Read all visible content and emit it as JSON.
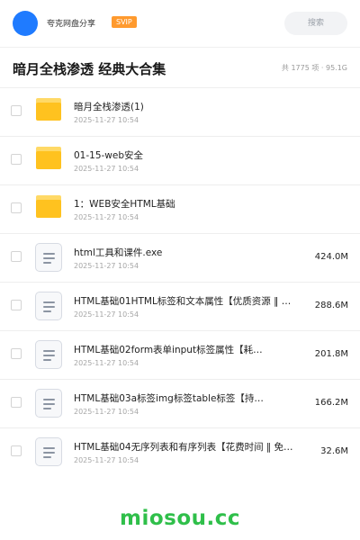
{
  "header": {
    "user_name": "夸克网盘分享",
    "badge": "SVIP",
    "search_label": "搜索"
  },
  "share": {
    "title": "暗月全栈渗透 经典大合集",
    "meta": "共 1775 项 · 95.1G"
  },
  "files": [
    {
      "type": "folder",
      "name": "暗月全栈渗透(1)",
      "date": "2025-11-27 10:54",
      "size": ""
    },
    {
      "type": "folder",
      "name": "01-15-web安全",
      "date": "2025-11-27 10:54",
      "size": ""
    },
    {
      "type": "folder",
      "name": "1：WEB安全HTML基础",
      "date": "2025-11-27 10:54",
      "size": ""
    },
    {
      "type": "file",
      "name": "html工具和课件.exe",
      "date": "2025-11-27 10:54",
      "size": "424.0M"
    },
    {
      "type": "file",
      "name": "HTML基础01HTML标签和文本属性【优质资源 ‖ …",
      "date": "2025-11-27 10:54",
      "size": "288.6M"
    },
    {
      "type": "file",
      "name": "HTML基础02form表单input标签属性【耗…",
      "date": "2025-11-27 10:54",
      "size": "201.8M"
    },
    {
      "type": "file",
      "name": "HTML基础03a标签img标签table标签【持…",
      "date": "2025-11-27 10:54",
      "size": "166.2M"
    },
    {
      "type": "file",
      "name": "HTML基础04无序列表和有序列表【花费时间 ‖ 免费…",
      "date": "2025-11-27 10:54",
      "size": "32.6M"
    }
  ],
  "watermark": "miosou.cc",
  "colors": {
    "avatar": "#1f7bff",
    "svip": "#ff9a2e",
    "folder": "#ffc21f",
    "watermark": "#2fbf4a"
  }
}
